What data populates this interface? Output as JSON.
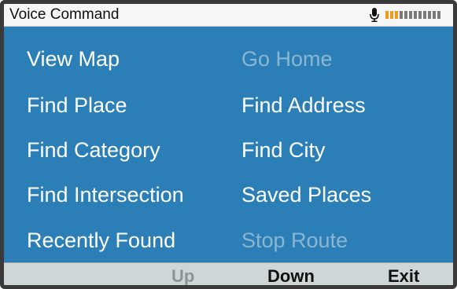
{
  "status_bar": {
    "title": "Voice Command",
    "mic_icon": "microphone-icon",
    "level": {
      "active_segments": 3,
      "total_segments": 12,
      "active_color": "#f29a1d",
      "inactive_color": "#7a7a7a"
    }
  },
  "menu": {
    "left_column": [
      {
        "label": "View Map",
        "enabled": true
      },
      {
        "label": "Find Place",
        "enabled": true
      },
      {
        "label": "Find Category",
        "enabled": true
      },
      {
        "label": "Find Intersection",
        "enabled": true
      },
      {
        "label": "Recently Found",
        "enabled": true
      }
    ],
    "right_column": [
      {
        "label": "Go Home",
        "enabled": false
      },
      {
        "label": "Find Address",
        "enabled": true
      },
      {
        "label": "Find City",
        "enabled": true
      },
      {
        "label": "Saved Places",
        "enabled": true
      },
      {
        "label": "Stop Route",
        "enabled": false
      }
    ]
  },
  "softkeys": {
    "up": {
      "label": "Up",
      "enabled": false
    },
    "down": {
      "label": "Down",
      "enabled": true
    },
    "exit": {
      "label": "Exit",
      "enabled": true
    }
  },
  "colors": {
    "menu_background": "#2b7fb6",
    "menu_text": "#ffffff",
    "menu_text_disabled": "#8ab6d2",
    "softkey_bar": "#cfd6d8"
  }
}
